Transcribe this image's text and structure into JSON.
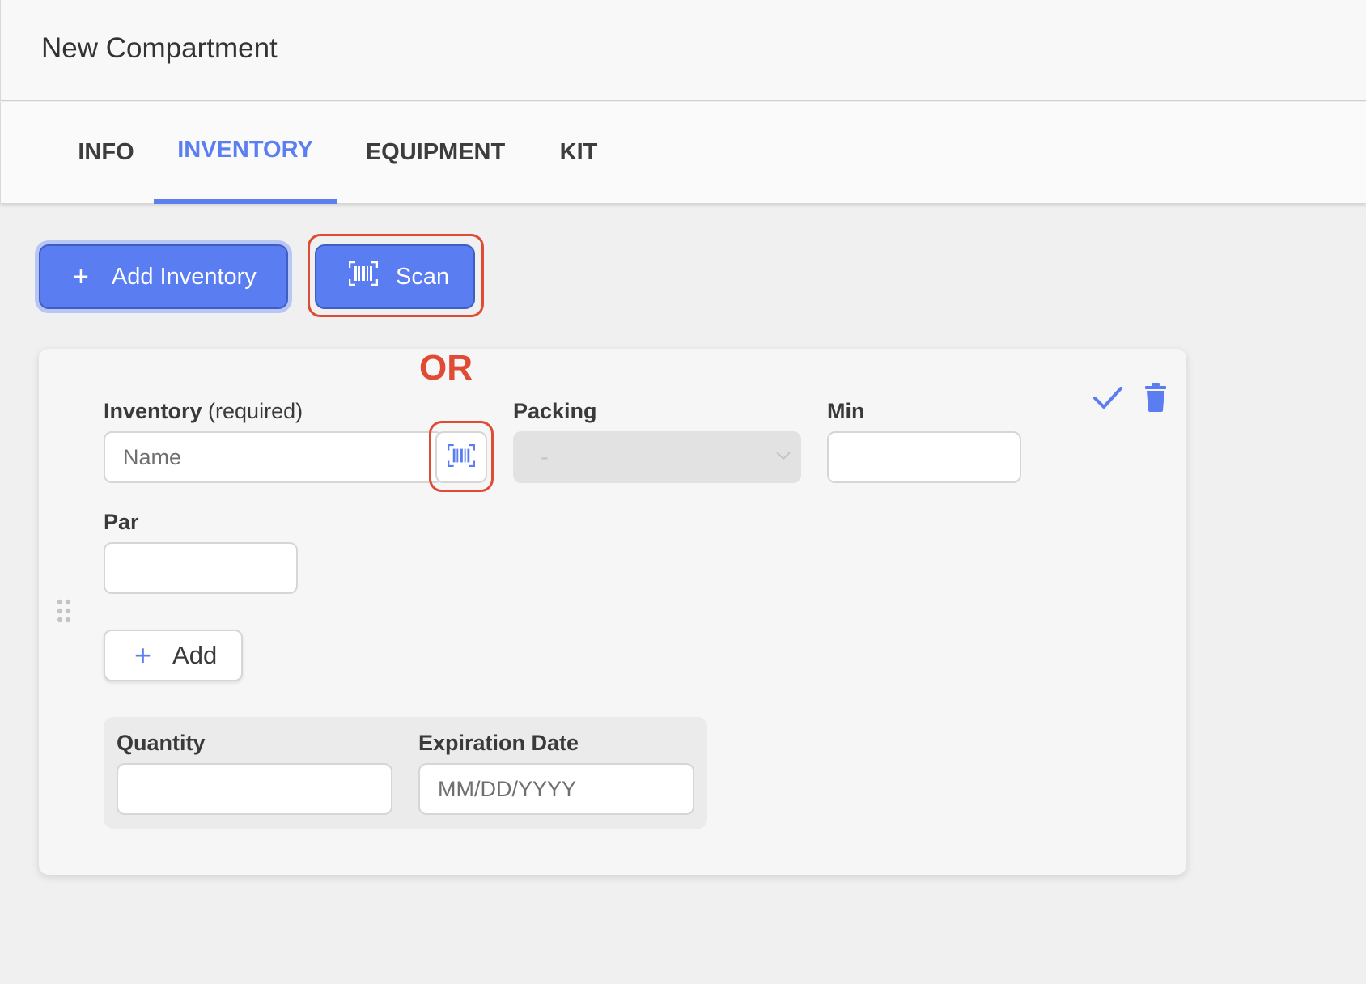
{
  "header": {
    "title": "New Compartment"
  },
  "tabs": [
    {
      "label": "INFO",
      "active": false
    },
    {
      "label": "INVENTORY",
      "active": true
    },
    {
      "label": "EQUIPMENT",
      "active": false
    },
    {
      "label": "KIT",
      "active": false
    }
  ],
  "toolbar": {
    "add_inventory_label": "Add Inventory",
    "scan_label": "Scan"
  },
  "annotation": {
    "or_label": "OR"
  },
  "form": {
    "inventory_label": "Inventory",
    "inventory_required": "(required)",
    "inventory_placeholder": "Name",
    "packing_label": "Packing",
    "packing_value": "-",
    "min_label": "Min",
    "par_label": "Par",
    "add_label": "Add",
    "quantity_label": "Quantity",
    "expiration_label": "Expiration Date",
    "expiration_placeholder": "MM/DD/YYYY"
  },
  "colors": {
    "accent": "#5a7df2",
    "highlight": "#e04b35",
    "page_bg": "#f0f0f0"
  },
  "icons": [
    "plus-icon",
    "barcode-icon",
    "checkmark-icon",
    "trash-icon",
    "drag-handle-icon",
    "chevron-down-icon"
  ]
}
